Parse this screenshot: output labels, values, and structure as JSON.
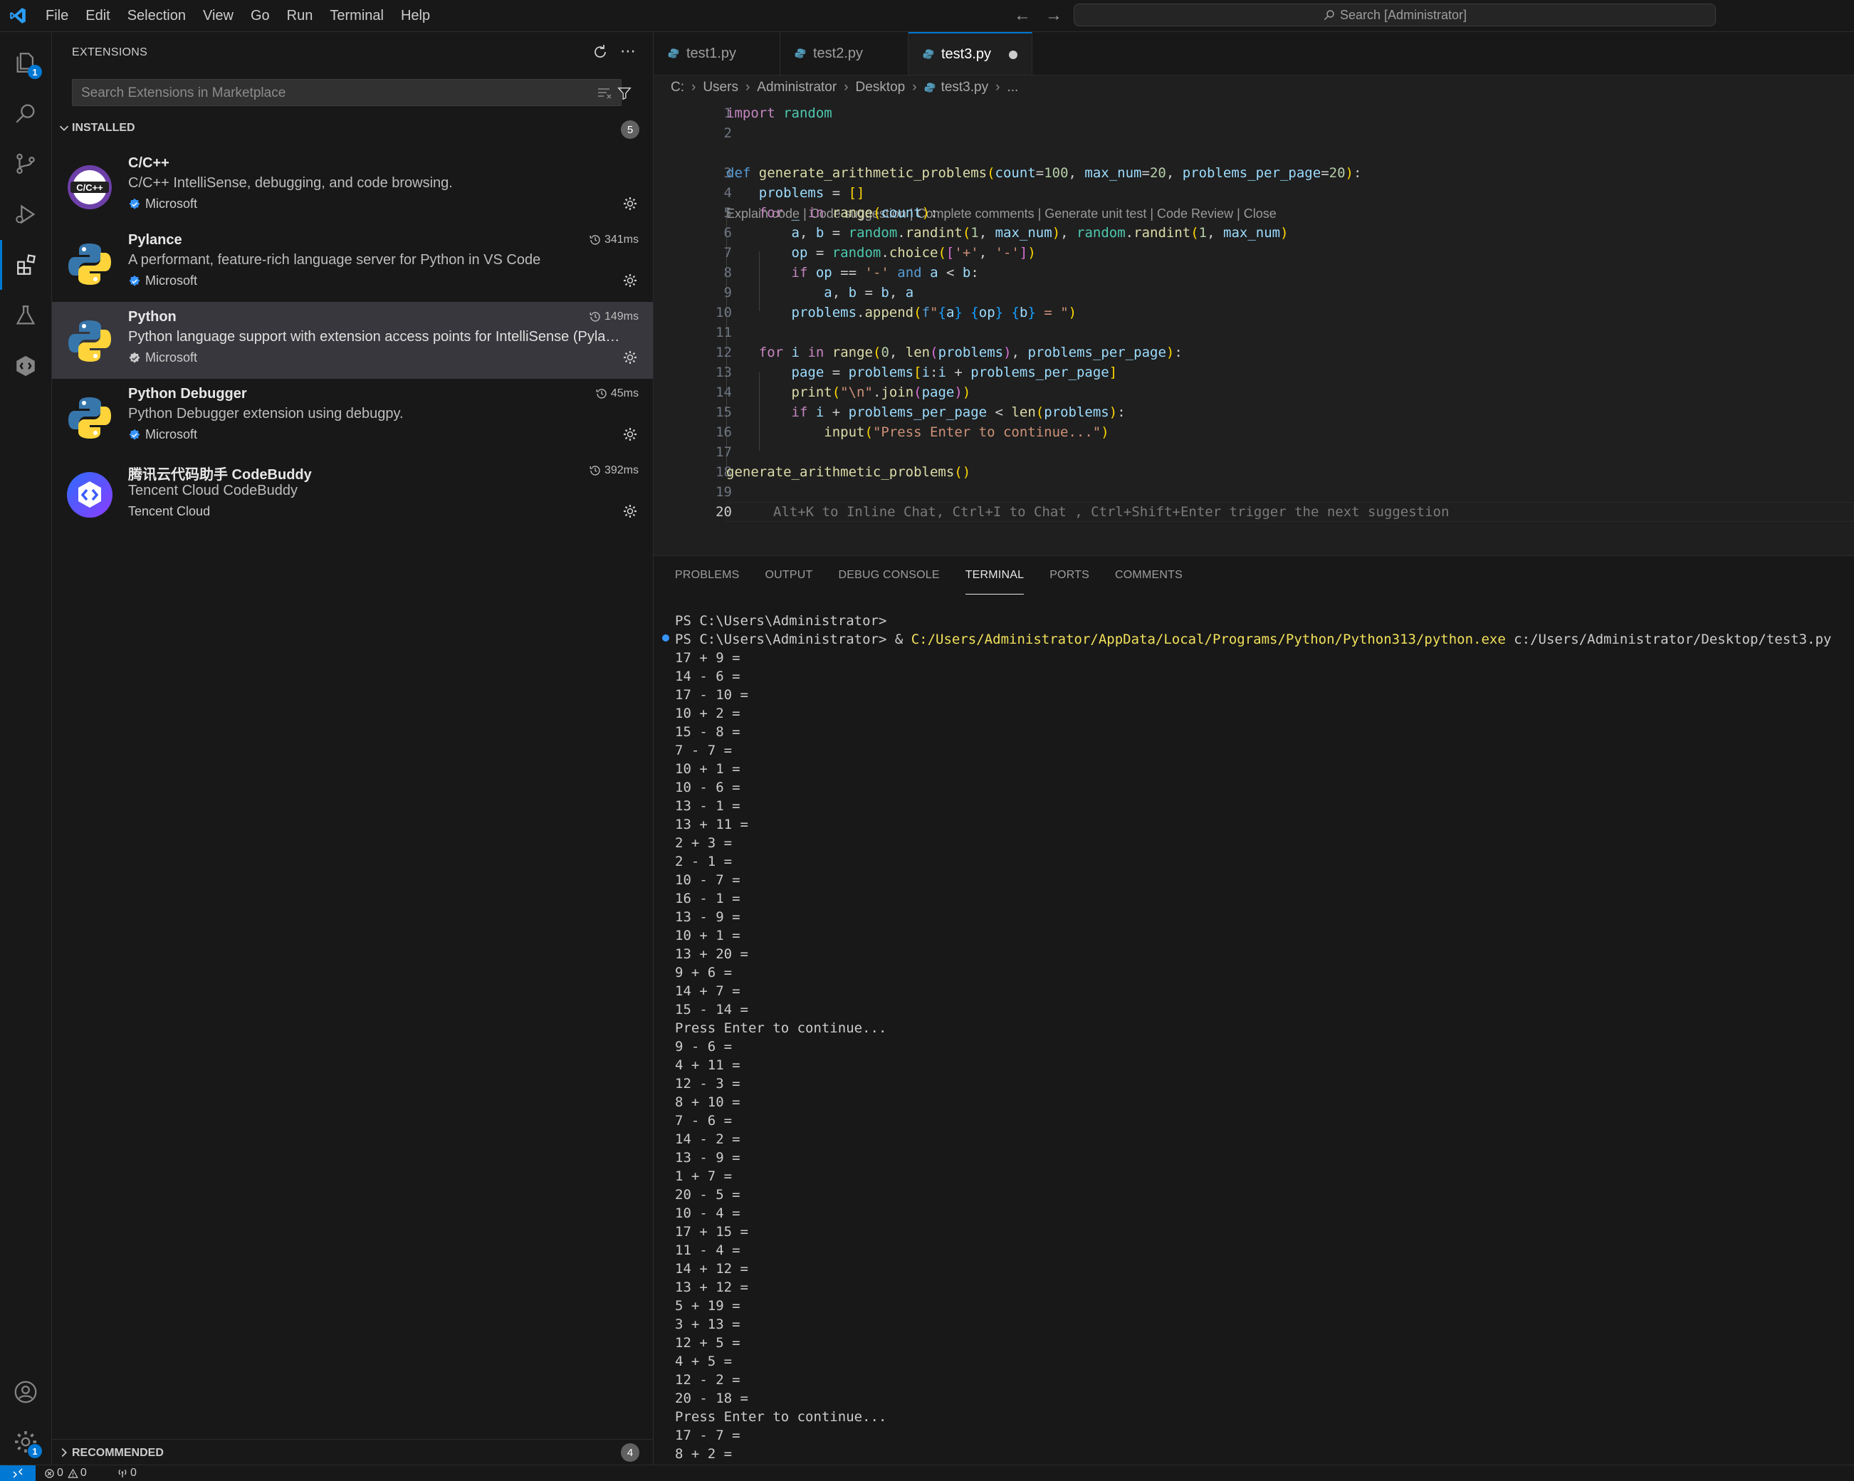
{
  "menubar": {
    "items": [
      "File",
      "Edit",
      "Selection",
      "View",
      "Go",
      "Run",
      "Terminal",
      "Help"
    ]
  },
  "command_center": {
    "placeholder": "Search [Administrator]"
  },
  "activity_bar": {
    "explorer_badge": "1",
    "settings_badge": "1"
  },
  "sidebar": {
    "title": "EXTENSIONS",
    "search_placeholder": "Search Extensions in Marketplace",
    "installed": {
      "label": "INSTALLED",
      "count": "5",
      "items": [
        {
          "name": "C/C++",
          "description": "C/C++ IntelliSense, debugging, and code browsing.",
          "publisher": "Microsoft",
          "verified": true,
          "time": "",
          "icon": "cpp-icon"
        },
        {
          "name": "Pylance",
          "description": "A performant, feature-rich language server for Python in VS Code",
          "publisher": "Microsoft",
          "verified": true,
          "time": "341ms",
          "icon": "python-icon"
        },
        {
          "name": "Python",
          "description": "Python language support with extension access points for IntelliSense (Pylance), D...",
          "publisher": "Microsoft",
          "verified": true,
          "time": "149ms",
          "icon": "python-icon"
        },
        {
          "name": "Python Debugger",
          "description": "Python Debugger extension using debugpy.",
          "publisher": "Microsoft",
          "verified": true,
          "time": "45ms",
          "icon": "python-icon"
        },
        {
          "name": "腾讯云代码助手 CodeBuddy",
          "description": "Tencent Cloud CodeBuddy",
          "publisher": "Tencent Cloud",
          "verified": false,
          "time": "392ms",
          "icon": "codebuddy-icon"
        }
      ]
    },
    "recommended": {
      "label": "RECOMMENDED",
      "count": "4"
    }
  },
  "editor": {
    "tabs": [
      {
        "label": "test1.py"
      },
      {
        "label": "test2.py"
      },
      {
        "label": "test3.py",
        "active": true,
        "dirty": true
      }
    ],
    "breadcrumb": [
      "C:",
      "Users",
      "Administrator",
      "Desktop",
      "test3.py",
      "..."
    ],
    "codelens": "Explain code | Code suggestion | Complete comments | Generate unit test | Code Review | Close",
    "line_numbers": [
      "1",
      "2",
      "3",
      "4",
      "5",
      "6",
      "7",
      "8",
      "9",
      "10",
      "11",
      "12",
      "13",
      "14",
      "15",
      "16",
      "17",
      "18",
      "19",
      "20"
    ],
    "current_line": "20",
    "inline_hint": "Alt+K to Inline Chat, Ctrl+I to Chat , Ctrl+Shift+Enter trigger the next suggestion"
  },
  "panel": {
    "tabs": [
      "PROBLEMS",
      "OUTPUT",
      "DEBUG CONSOLE",
      "TERMINAL",
      "PORTS",
      "COMMENTS"
    ],
    "active_tab": "TERMINAL",
    "terminal": {
      "line1": "PS C:\\Users\\Administrator>",
      "prompt2": "PS C:\\Users\\Administrator> & ",
      "exe": "C:/Users/Administrator/AppData/Local/Programs/Python/Python313/python.exe",
      "script": " c:/Users/Administrator/Desktop/test3.py",
      "output": [
        "17 + 9 =",
        "14 - 6 =",
        "17 - 10 =",
        "10 + 2 =",
        "15 - 8 =",
        "7 - 7 =",
        "10 + 1 =",
        "10 - 6 =",
        "13 - 1 =",
        "13 + 11 =",
        "2 + 3 =",
        "2 - 1 =",
        "10 - 7 =",
        "16 - 1 =",
        "13 - 9 =",
        "10 + 1 =",
        "13 + 20 =",
        "9 + 6 =",
        "14 + 7 =",
        "15 - 14 =",
        "Press Enter to continue...",
        "9 - 6 =",
        "4 + 11 =",
        "12 - 3 =",
        "8 + 10 =",
        "7 - 6 =",
        "14 - 2 =",
        "13 - 9 =",
        "1 + 7 =",
        "20 - 5 =",
        "10 - 4 =",
        "17 + 15 =",
        "11 - 4 =",
        "14 + 12 =",
        "13 + 12 =",
        "5 + 19 =",
        "3 + 13 =",
        "12 + 5 =",
        "4 + 5 =",
        "12 - 2 =",
        "20 - 18 =",
        "Press Enter to continue...",
        "17 - 7 =",
        "8 + 2 ="
      ]
    }
  },
  "statusbar": {
    "errors": "0",
    "warnings": "0",
    "ports": "0"
  }
}
